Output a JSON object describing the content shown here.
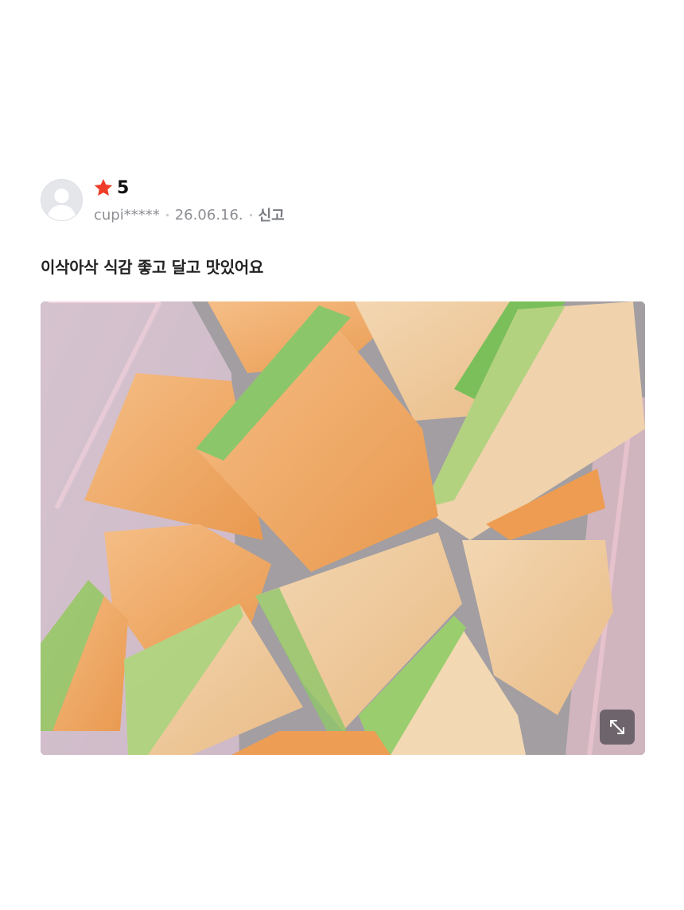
{
  "review": {
    "rating": "5",
    "username": "cupi*****",
    "date": "26.06.16.",
    "report_label": "신고",
    "text": "이삭아삭 식감 좋고 달고 맛있어요"
  },
  "icons": {
    "avatar": "default-user-avatar",
    "star": "star-icon",
    "expand": "expand-diagonal-icon"
  },
  "colors": {
    "star": "#f03c2a",
    "rating_text": "#111111",
    "meta_text": "#8d8f94",
    "review_text": "#222222"
  }
}
